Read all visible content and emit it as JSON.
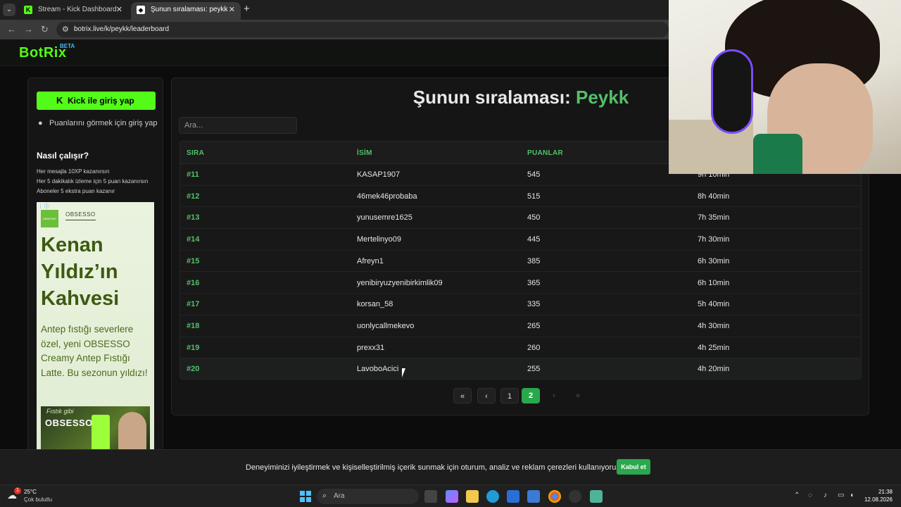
{
  "browser": {
    "tabs": [
      {
        "title": "Stream - Kick Dashboard",
        "icon": "kick-icon",
        "active": false
      },
      {
        "title": "Şunun sıralaması: peykk | Yayın",
        "icon": "botrix-icon",
        "active": true
      }
    ],
    "url": "botrix.live/k/peykk/leaderboard"
  },
  "site": {
    "logo": "BotRix",
    "beta": "BETA"
  },
  "sidebar": {
    "login_button": "Kick ile giriş yap",
    "login_hint": "Puanlarını görmek için giriş yap",
    "how_title": "Nasıl çalışır?",
    "how_lines": [
      "Her mesajla 10XP kazanırsın",
      "Her 5 dakikalık izleme için 5 puan kazanırsın",
      "Aboneler 5 ekstra puan kazanır"
    ],
    "ad": {
      "brand": "OBSESSO",
      "logo_text": "OBSESSO",
      "headline": "Kenan Yıldız’ın Kahvesi",
      "description": "Antep fıstığı severlere özel, yeni OBSESSO Creamy Antep Fıstığı Latte. Bu sezonun yıldızı!",
      "image_caption": "Fıstık gibi",
      "image_brand": "OBSESSO"
    }
  },
  "leaderboard": {
    "title_prefix": "Şunun sıralaması:",
    "title_name": "Peykk",
    "search_placeholder": "Ara...",
    "columns": [
      "SIRA",
      "İSİM",
      "PUANLAR",
      ""
    ],
    "rows": [
      {
        "rank": "#11",
        "name": "KASAP1907",
        "points": "545",
        "time": "9h 10min"
      },
      {
        "rank": "#12",
        "name": "46mek46probaba",
        "points": "515",
        "time": "8h 40min"
      },
      {
        "rank": "#13",
        "name": "yunusemre1625",
        "points": "450",
        "time": "7h 35min"
      },
      {
        "rank": "#14",
        "name": "Mertelinyo09",
        "points": "445",
        "time": "7h 30min"
      },
      {
        "rank": "#15",
        "name": "Afreyn1",
        "points": "385",
        "time": "6h 30min"
      },
      {
        "rank": "#16",
        "name": "yenibiryuzyenibirkimlik09",
        "points": "365",
        "time": "6h 10min"
      },
      {
        "rank": "#17",
        "name": "korsan_58",
        "points": "335",
        "time": "5h 40min"
      },
      {
        "rank": "#18",
        "name": "uonlycallmekevo",
        "points": "265",
        "time": "4h 30min"
      },
      {
        "rank": "#19",
        "name": "prexx31",
        "points": "260",
        "time": "4h 25min"
      },
      {
        "rank": "#20",
        "name": "LavoboAcici",
        "points": "255",
        "time": "4h 20min"
      }
    ],
    "pagination": {
      "first": "«",
      "prev": "‹",
      "pages": [
        "1",
        "2"
      ],
      "current": "2",
      "next": "›",
      "last": "»"
    }
  },
  "cookie": {
    "message": "Deneyiminizi iyileştirmek ve kişiselleştirilmiş içerik sunmak için oturum, analiz ve reklam çerezleri kullanıyoruz.",
    "accept": "Kabul et"
  },
  "taskbar": {
    "weather_temp": "25°C",
    "weather_cond": "Çok bulutlu",
    "weather_badge": "1",
    "search_label": "Ara",
    "time": "21:38",
    "date": "12.08.2026"
  },
  "colors": {
    "kick_green": "#53fc18",
    "accent_green": "#53c06a",
    "active_page": "#29a84d",
    "page_bg": "#0c0c0c"
  }
}
